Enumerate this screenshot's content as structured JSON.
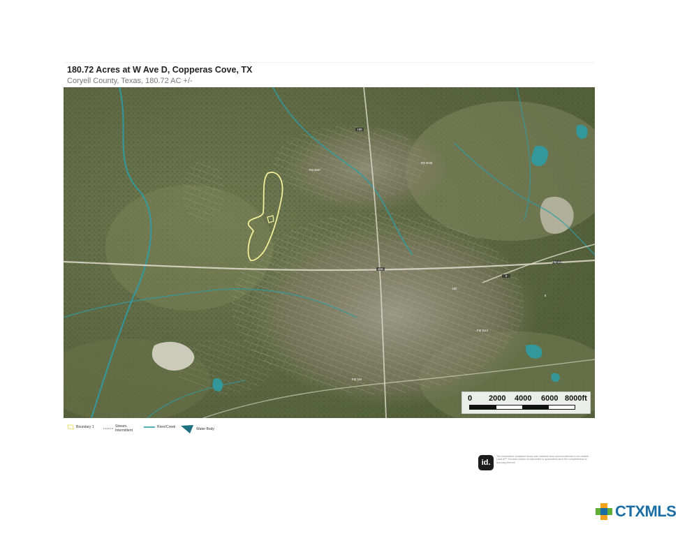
{
  "title": "180.72 Acres at W Ave D, Copperas Cove, TX",
  "subtitle": "Coryell County, Texas, 180.72 AC +/-",
  "scale": {
    "labels": [
      "0",
      "2000",
      "4000",
      "6000",
      "8000ft"
    ]
  },
  "legend": [
    {
      "label": "Boundary 1",
      "icon": "boundary-icon"
    },
    {
      "label": "Stream, Intermittent",
      "icon": "dotted-line-icon"
    },
    {
      "label": "River/Creek",
      "icon": "river-line-icon"
    },
    {
      "label": "Water Body",
      "icon": "water-body-icon"
    }
  ],
  "disclaimer": {
    "badge": "id.",
    "text": "The information contained herein was obtained from sources deemed to be reliable. Land id™ Services makes no warranties or guarantees as to the completeness or accuracy thereof."
  },
  "brand": {
    "name": "CTXMLS",
    "icon": "texas-cross-logo"
  },
  "colors": {
    "boundary": "#f4f09a",
    "water": "#2f9ca3",
    "accent_orange": "#f4a21a",
    "accent_green": "#5fae38",
    "accent_blue": "#1b6ea3"
  },
  "map": {
    "labels": [
      "190",
      "116",
      "9",
      "FM 116",
      "FM 2657",
      "FM 3046",
      "190",
      "FM 1113",
      "9",
      "FM 116"
    ]
  }
}
